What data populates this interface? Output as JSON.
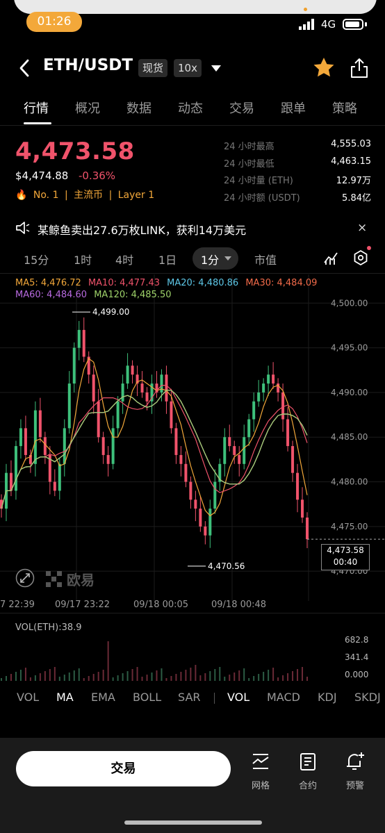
{
  "status": {
    "time": "01:26",
    "network": "4G"
  },
  "header": {
    "pair": "ETH/USDT",
    "market_tag": "现货",
    "leverage_tag": "10x"
  },
  "tabs": [
    "行情",
    "概况",
    "数据",
    "动态",
    "交易",
    "跟单",
    "策略"
  ],
  "price": {
    "last": "4,473.58",
    "fiat": "$4,474.88",
    "change": "-0.36%",
    "tags": [
      "No. 1",
      "|",
      "主流币",
      "|",
      "Layer 1"
    ]
  },
  "stats": [
    {
      "label": "24 小时最高",
      "value": "4,555.03"
    },
    {
      "label": "24 小时最低",
      "value": "4,463.15"
    },
    {
      "label": "24 小时量 (ETH)",
      "value": "12.97万"
    },
    {
      "label": "24 小时额 (USDT)",
      "value": "5.84亿"
    }
  ],
  "news": {
    "text": "某鲸鱼卖出27.6万枚LINK，获利14万美元",
    "close": "×"
  },
  "intervals": {
    "items": [
      "15分",
      "1时",
      "4时",
      "1日"
    ],
    "active": "1分",
    "extra": "市值"
  },
  "ma_legend": {
    "ma5": "MA5: 4,476.72",
    "ma10": "MA10: 4,477.43",
    "ma20": "MA20: 4,480.86",
    "ma30": "MA30: 4,484.09",
    "ma60": "MA60: 4,484.60",
    "ma120": "MA120: 4,485.50"
  },
  "chart_data": {
    "type": "candlestick",
    "y_axis_ticks": [
      "4,500.00",
      "4,495.00",
      "4,490.00",
      "4,485.00",
      "4,480.00",
      "4,475.00",
      "4,470.00"
    ],
    "ylim": [
      4469,
      4501.5
    ],
    "x_axis_ticks": [
      "7 22:39",
      "09/17 23:22",
      "09/18 00:05",
      "09/18 00:48"
    ],
    "high_marker": "4,499.00",
    "low_marker": "4,470.56",
    "current_price": "4,473.58",
    "countdown": "00:40",
    "close_series": [
      4477,
      4481,
      4479,
      4484,
      4486,
      4483,
      4482,
      4488,
      4485,
      4483,
      4480,
      4479,
      4482,
      4486,
      4491,
      4495,
      4497,
      4494,
      4492,
      4489,
      4485,
      4483,
      4482,
      4486,
      4489,
      4491,
      4493,
      4492,
      4491,
      4490,
      4489,
      4491,
      4490,
      4492,
      4489,
      4486,
      4483,
      4482,
      4480,
      4478,
      4477,
      4475,
      4474,
      4477,
      4480,
      4482,
      4485,
      4484,
      4483,
      4482,
      4485,
      4487,
      4489,
      4490,
      4491,
      4492,
      4491,
      4490,
      4487,
      4484,
      4481,
      4478,
      4476,
      4473.58
    ]
  },
  "volume": {
    "label": "VOL(ETH):38.9",
    "axis": [
      "682.8",
      "341.4",
      "0.000"
    ]
  },
  "indicators": {
    "left": [
      "VOL",
      "MA",
      "EMA",
      "BOLL",
      "SAR"
    ],
    "left_active": "MA",
    "right": [
      "VOL",
      "MACD",
      "KDJ",
      "SKDJ"
    ],
    "right_active": "VOL"
  },
  "bottom": {
    "trade": "交易",
    "tools": [
      "网格",
      "合约",
      "预警"
    ]
  },
  "watermark": "欧易",
  "colors": {
    "up": "#3ec07b",
    "down": "#f0536b",
    "accent": "#f3a83a"
  }
}
